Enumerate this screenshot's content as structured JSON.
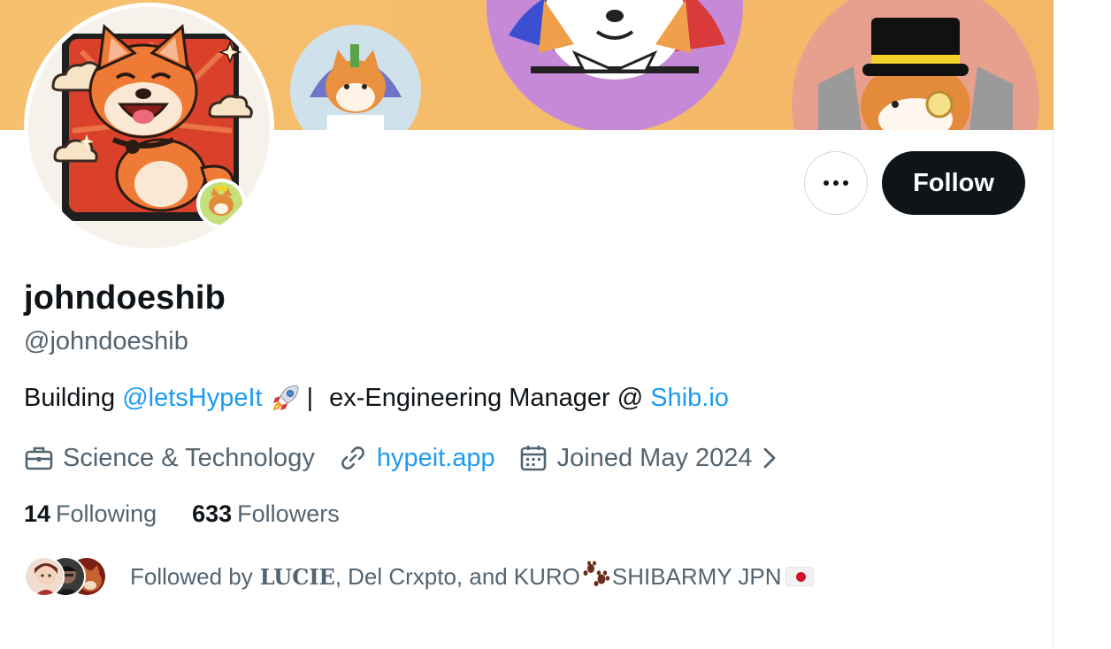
{
  "profile": {
    "display_name": "johndoeshib",
    "handle": "@johndoeshib",
    "bio": {
      "prefix": "Building",
      "mention": "@letsHypeIt",
      "separator": "|",
      "middle": "ex-Engineering Manager @",
      "link": "Shib.io"
    },
    "category": "Science & Technology",
    "website": "hypeit.app",
    "joined": "Joined May 2024"
  },
  "actions": {
    "more_icon": "more-horizontal-icon",
    "follow_label": "Follow"
  },
  "stats": {
    "following_count": "14",
    "following_label": "Following",
    "followers_count": "633",
    "followers_label": "Followers"
  },
  "followed_by": {
    "prefix": "Followed by",
    "name1": "LUCIE",
    "sep1": ",",
    "name2": "Del Crxpto",
    "sep2": ", and",
    "name3_prefix": "KURO",
    "name3_suffix": "SHIBARMY JPN"
  },
  "icons": {
    "category": "briefcase-icon",
    "website": "link-icon",
    "joined": "calendar-icon",
    "joined_more": "chevron-right-icon"
  },
  "colors": {
    "accent": "#1d9bf0",
    "primary_text": "#0f1419",
    "secondary_text": "#536471",
    "banner": "#f5be6a",
    "follow_button": "#0f1419"
  }
}
